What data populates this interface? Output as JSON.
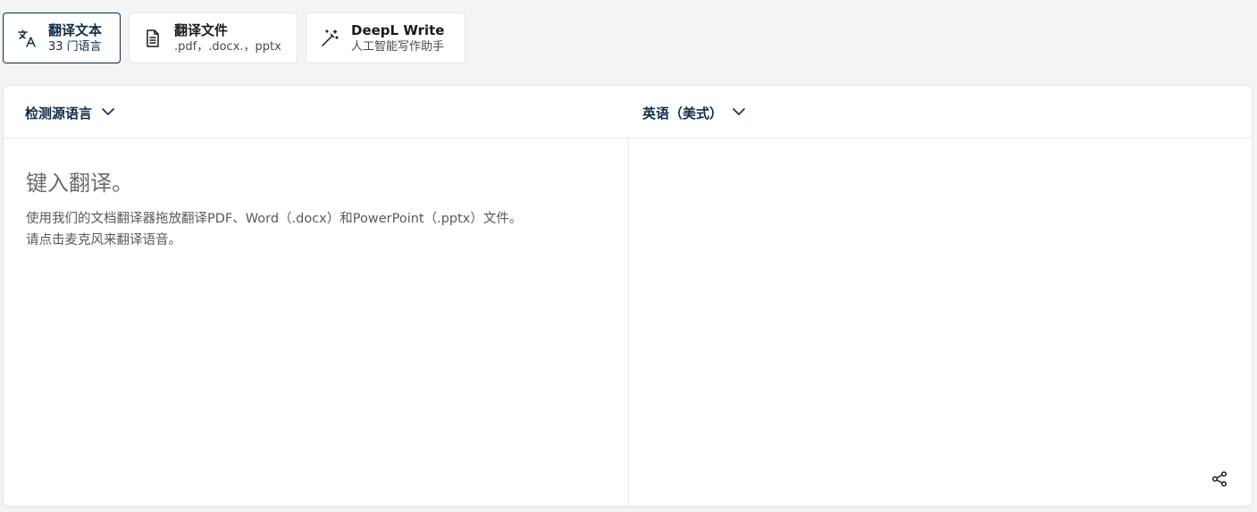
{
  "tabs": [
    {
      "title": "翻译文本",
      "sub": "33 门语言",
      "icon": "translate-icon",
      "active": true
    },
    {
      "title": "翻译文件",
      "sub": ".pdf，.docx.，pptx",
      "icon": "document-icon",
      "active": false
    },
    {
      "title": "DeepL Write",
      "sub": "人工智能写作助手",
      "icon": "magic-wand-icon",
      "active": false
    }
  ],
  "translator": {
    "source_lang": "检测源语言",
    "target_lang": "英语（美式）",
    "placeholder": "键入翻译。",
    "hint_line1": "使用我们的文档翻译器拖放翻译PDF、Word（.docx）和PowerPoint（.pptx）文件。",
    "hint_line2": "请点击麦克风来翻译语音。"
  },
  "colors": {
    "accent": "#0f2b46",
    "background": "#f4f4f4",
    "panel": "#ffffff"
  }
}
